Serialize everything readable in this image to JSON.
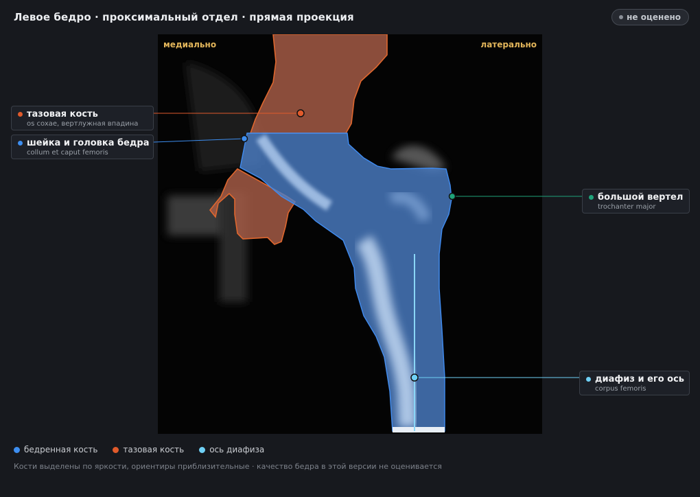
{
  "header": {
    "title": "Левое бедро · проксимальный отдел · прямая проекция",
    "status": "не оценено"
  },
  "viewer": {
    "orientation_left": "медиально",
    "orientation_right": "латерально"
  },
  "labels": {
    "pelvis": {
      "name": "тазовая кость",
      "latin": "os coxae, вертлужная впадина",
      "color": "#e05a2b"
    },
    "neck": {
      "name": "шейка и головка бедра",
      "latin": "collum et caput femoris",
      "color": "#3d8ef0"
    },
    "trochanter": {
      "name": "большой вертел",
      "latin": "trochanter major",
      "color": "#1fa37a"
    },
    "shaft": {
      "name": "диафиз и его ось",
      "latin": "corpus femoris",
      "color": "#6fd0f5"
    }
  },
  "legend": [
    {
      "label": "бедренная кость",
      "color": "#3d8ef0"
    },
    {
      "label": "тазовая кость",
      "color": "#e05a2b"
    },
    {
      "label": "ось диафиза",
      "color": "#6fd0f5"
    }
  ],
  "footnote": "Кости выделены по яркости, ориентиры приблизительные · качество бедра в этой версии не оценивается"
}
